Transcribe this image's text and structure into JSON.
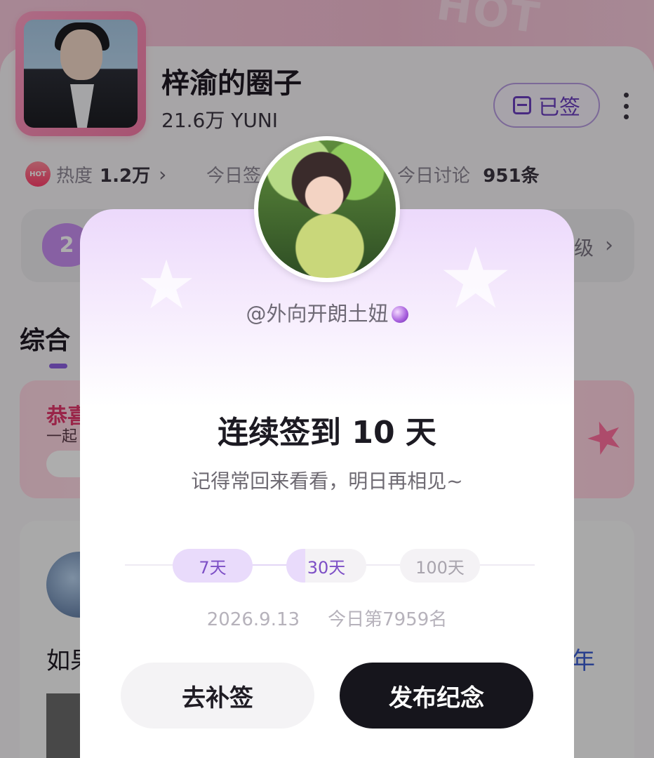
{
  "circle": {
    "title": "梓渝的圈子",
    "members": "21.6万 YUNI",
    "signed_label": "已签",
    "stats": {
      "heat_label": "热度",
      "heat_value": "1.2万",
      "today_sign_label": "今日签",
      "today_discuss_label": "今日讨论",
      "today_discuss_value": "951条"
    },
    "level_badge": "2",
    "level_text": "级",
    "tab_active": "综合",
    "promo_title": "恭喜",
    "promo_sub": "一起",
    "post_text_left": "如果",
    "post_text_right": "年"
  },
  "modal": {
    "username": "@外向开朗土妞",
    "streak_title": "连续签到 10 天",
    "streak_subtitle": "记得常回来看看，明日再相见~",
    "milestones": [
      "7天",
      "30天",
      "100天"
    ],
    "date": "2026.9.13",
    "rank": "今日第7959名",
    "makeup_button": "去补签",
    "publish_button": "发布纪念"
  },
  "colors": {
    "accent_purple": "#7d4fc6",
    "publish_button_bg": "#16151c",
    "promo_pink": "#e2366b"
  },
  "icons": [
    "calendar-icon",
    "more-icon",
    "hot-icon",
    "chevron-right-icon",
    "star-wand-icon",
    "crystal-ball-icon"
  ]
}
